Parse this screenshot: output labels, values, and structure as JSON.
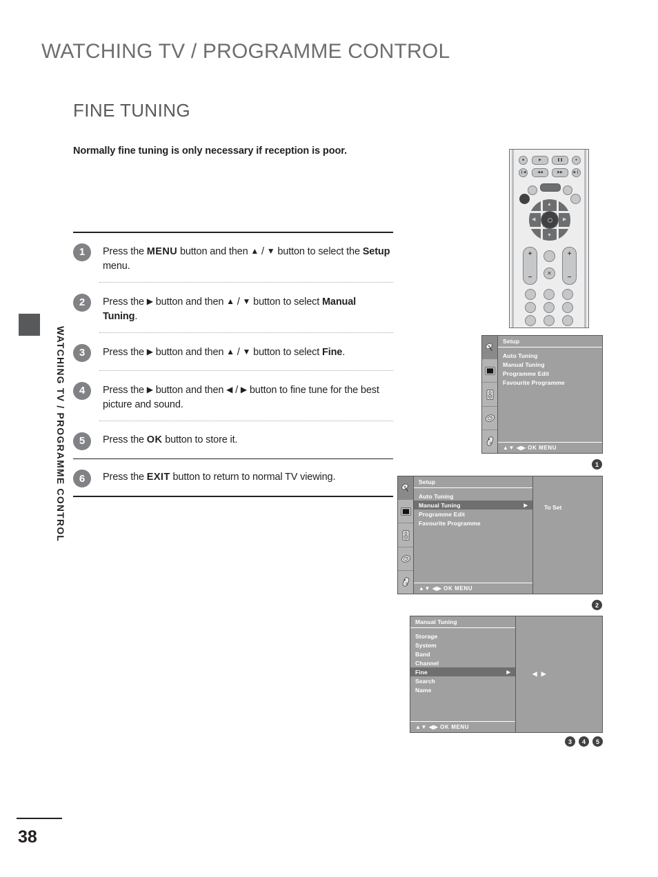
{
  "header": {
    "title": "WATCHING TV / PROGRAMME CONTROL"
  },
  "section": {
    "title": "FINE TUNING",
    "intro": "Normally fine tuning is only necessary if reception is poor."
  },
  "sidebar": {
    "vertical_label": "WATCHING TV / PROGRAMME CONTROL"
  },
  "footer": {
    "page_number": "38"
  },
  "steps": [
    {
      "number": "1",
      "parts": [
        {
          "text": "Press the ",
          "style": "normal"
        },
        {
          "text": "MENU",
          "style": "key"
        },
        {
          "text": " button and then ",
          "style": "normal"
        },
        {
          "text": "▲",
          "style": "arrow"
        },
        {
          "text": " / ",
          "style": "normal"
        },
        {
          "text": "▼",
          "style": "arrow"
        },
        {
          "text": " button to select the ",
          "style": "normal"
        },
        {
          "text": "Setup",
          "style": "bold"
        },
        {
          "text": " menu.",
          "style": "normal"
        }
      ]
    },
    {
      "number": "2",
      "parts": [
        {
          "text": "Press the ",
          "style": "normal"
        },
        {
          "text": "▶",
          "style": "arrow"
        },
        {
          "text": " button and then ",
          "style": "normal"
        },
        {
          "text": "▲",
          "style": "arrow"
        },
        {
          "text": " / ",
          "style": "normal"
        },
        {
          "text": "▼",
          "style": "arrow"
        },
        {
          "text": " button to select ",
          "style": "normal"
        },
        {
          "text": "Manual Tuning",
          "style": "bold"
        },
        {
          "text": ".",
          "style": "normal"
        }
      ]
    },
    {
      "number": "3",
      "parts": [
        {
          "text": "Press the ",
          "style": "normal"
        },
        {
          "text": "▶",
          "style": "arrow"
        },
        {
          "text": " button and then ",
          "style": "normal"
        },
        {
          "text": "▲",
          "style": "arrow"
        },
        {
          "text": " / ",
          "style": "normal"
        },
        {
          "text": "▼",
          "style": "arrow"
        },
        {
          "text": " button to select ",
          "style": "normal"
        },
        {
          "text": "Fine",
          "style": "bold"
        },
        {
          "text": ".",
          "style": "normal"
        }
      ]
    },
    {
      "number": "4",
      "parts": [
        {
          "text": "Press the ",
          "style": "normal"
        },
        {
          "text": "▶",
          "style": "arrow"
        },
        {
          "text": " button and then ",
          "style": "normal"
        },
        {
          "text": "◀",
          "style": "arrow"
        },
        {
          "text": " / ",
          "style": "normal"
        },
        {
          "text": "▶",
          "style": "arrow"
        },
        {
          "text": " button to fine tune for the best picture and sound.",
          "style": "normal"
        }
      ]
    },
    {
      "number": "5",
      "parts": [
        {
          "text": "Press the ",
          "style": "normal"
        },
        {
          "text": "OK",
          "style": "key"
        },
        {
          "text": " button to store it.",
          "style": "normal"
        }
      ]
    },
    {
      "number": "6",
      "parts": [
        {
          "text": "Press the ",
          "style": "normal"
        },
        {
          "text": "EXIT",
          "style": "key"
        },
        {
          "text": " button to return to normal TV viewing.",
          "style": "normal"
        }
      ]
    }
  ],
  "remote": {
    "transport_row1": [
      "stop-icon",
      "play-icon",
      "pause-icon",
      "record-icon"
    ],
    "transport_row2": [
      "skip-back-icon",
      "rewind-icon",
      "fast-forward-icon",
      "skip-forward-icon"
    ],
    "dpad": {
      "up": "▲",
      "down": "▼",
      "left": "◀",
      "right": "▶",
      "center": "ok-button"
    },
    "left_rocker": {
      "plus": "+",
      "minus": "−"
    },
    "right_rocker": {
      "plus": "+",
      "minus": "−"
    },
    "mute_icon": "mute-icon"
  },
  "osd_icons": [
    "satellite-dish-icon",
    "picture-screen-icon",
    "audio-speaker-icon",
    "clock-icon",
    "options-icon"
  ],
  "osd1": {
    "title": "Setup",
    "items": [
      {
        "label": "Auto Tuning",
        "selected": false,
        "arrow": ""
      },
      {
        "label": "Manual Tuning",
        "selected": false,
        "arrow": ""
      },
      {
        "label": "Programme Edit",
        "selected": false,
        "arrow": ""
      },
      {
        "label": "Favourite Programme",
        "selected": false,
        "arrow": ""
      }
    ],
    "footer": "▲▼  ◀▶  OK  MENU",
    "marker": "1"
  },
  "osd2": {
    "title": "Setup",
    "items": [
      {
        "label": "Auto Tuning",
        "selected": false,
        "arrow": ""
      },
      {
        "label": "Manual Tuning",
        "selected": true,
        "arrow": "▶"
      },
      {
        "label": "Programme Edit",
        "selected": false,
        "arrow": ""
      },
      {
        "label": "Favourite Programme",
        "selected": false,
        "arrow": ""
      }
    ],
    "footer": "▲▼  ◀▶  OK  MENU",
    "side_label": "To Set",
    "marker": "2"
  },
  "osd3": {
    "title": "Manual Tuning",
    "items": [
      {
        "label": "Storage",
        "selected": false,
        "arrow": ""
      },
      {
        "label": "System",
        "selected": false,
        "arrow": ""
      },
      {
        "label": "Band",
        "selected": false,
        "arrow": ""
      },
      {
        "label": "Channel",
        "selected": false,
        "arrow": ""
      },
      {
        "label": "Fine",
        "selected": true,
        "arrow": "▶"
      },
      {
        "label": "Search",
        "selected": false,
        "arrow": ""
      },
      {
        "label": "Name",
        "selected": false,
        "arrow": ""
      }
    ],
    "footer": "▲▼  ◀▶  OK  MENU",
    "side_label": "◀ ▶",
    "markers": [
      "3",
      "4",
      "5"
    ]
  },
  "colors": {
    "header_gray": "#6d6e70",
    "title_gray": "#58595b",
    "badge_gray": "#808285",
    "osd_panel": "#a0a0a0",
    "osd_selected": "#6f6f6f",
    "osd_iconbar": "#b4b4b4",
    "text_black": "#231f20"
  }
}
